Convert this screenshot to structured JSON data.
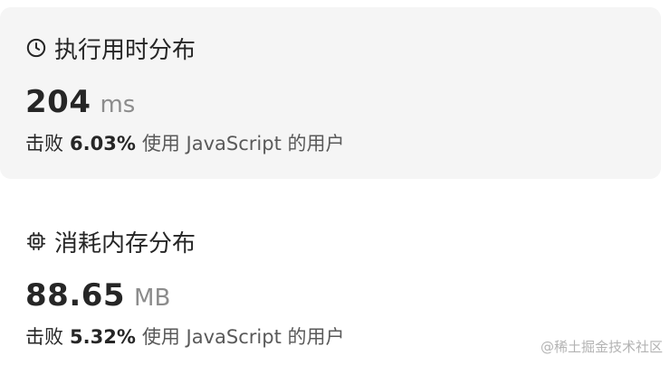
{
  "runtime": {
    "title": "执行用时分布",
    "icon": "clock-icon",
    "value": "204",
    "unit": "ms",
    "beats_prefix": "击败",
    "beats_percent": "6.03%",
    "beats_suffix": "使用 JavaScript 的用户"
  },
  "memory": {
    "title": "消耗内存分布",
    "icon": "chip-icon",
    "value": "88.65",
    "unit": "MB",
    "beats_prefix": "击败",
    "beats_percent": "5.32%",
    "beats_suffix": "使用 JavaScript 的用户"
  },
  "watermark": "@稀土掘金技术社区",
  "colors": {
    "card_bg": "#f5f5f5",
    "text_primary": "#262626",
    "text_secondary": "#8c8c8c"
  }
}
